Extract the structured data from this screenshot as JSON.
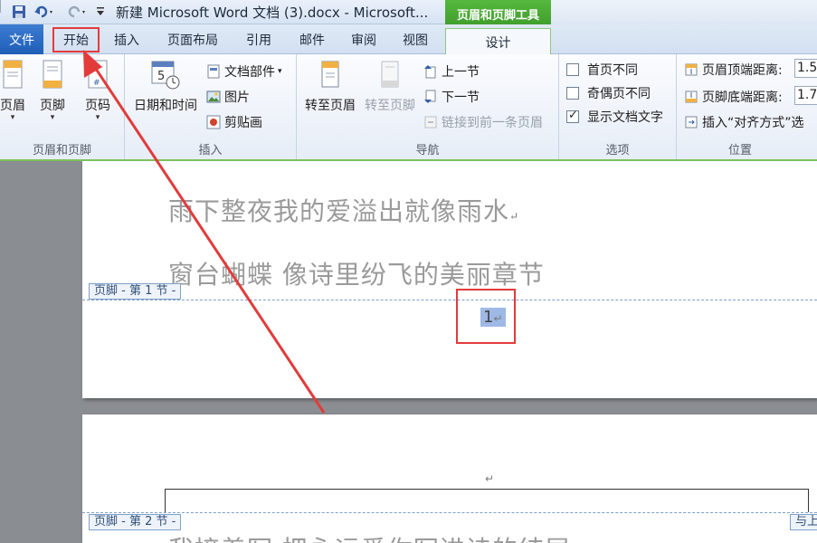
{
  "window": {
    "title": "新建 Microsoft Word 文档 (3).docx - Microsoft...",
    "context_tab_group": "页眉和页脚工具"
  },
  "quick_access": {
    "icons": [
      "save-icon",
      "undo-icon",
      "redo-icon",
      "customize-icon"
    ]
  },
  "tabs": {
    "file": "文件",
    "home": "开始",
    "insert": "插入",
    "layout": "页面布局",
    "references": "引用",
    "mailings": "邮件",
    "review": "审阅",
    "view": "视图",
    "design": "设计"
  },
  "ribbon": {
    "hf_group": {
      "label": "页眉和页脚",
      "header": "页眉",
      "footer": "页脚",
      "page_number": "页码"
    },
    "insert_group": {
      "label": "插入",
      "datetime": "日期和时间",
      "quick_parts": "文档部件",
      "picture": "图片",
      "clipart": "剪贴画"
    },
    "nav_group": {
      "label": "导航",
      "goto_header": "转至页眉",
      "goto_footer": "转至页脚",
      "previous": "上一节",
      "next": "下一节",
      "link_previous": "链接到前一条页眉"
    },
    "options_group": {
      "label": "选项",
      "different_first": "首页不同",
      "different_odd_even": "奇偶页不同",
      "show_doc_text": "显示文档文字",
      "different_first_checked": false,
      "different_odd_even_checked": false,
      "show_doc_text_checked": true
    },
    "position_group": {
      "label": "位置",
      "header_from_top": "页眉顶端距离:",
      "footer_from_bottom": "页脚底端距离:",
      "insert_align_tab": "插入“对齐方式”选",
      "header_value": "1.5",
      "footer_value": "1.7"
    }
  },
  "document": {
    "page1": {
      "line1": "雨下整夜我的爱溢出就像雨水",
      "line2": "窗台蝴蝶  像诗里纷飞的美丽章节",
      "footer_tag": "页脚 - 第 1 节 -",
      "page_number": "1"
    },
    "page2": {
      "footer_tag": "页脚 - 第 2 节 -",
      "same_as_previous": "与上",
      "line1": "我接着写  把永远爱你写进诗的结尾"
    },
    "paragraph_mark": "↵"
  },
  "colors": {
    "highlight_red": "#e33b3b",
    "context_green": "#4aa934",
    "file_tab_blue": "#2a6cc4"
  }
}
